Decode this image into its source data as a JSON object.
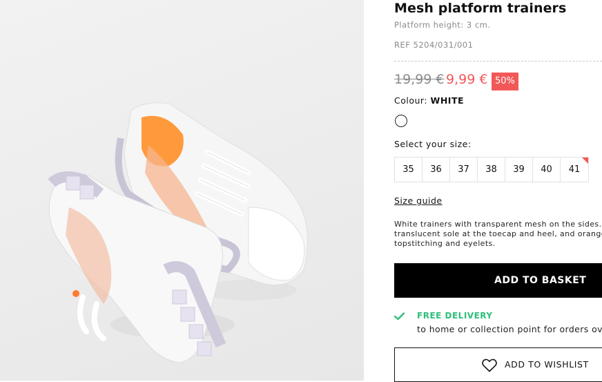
{
  "product": {
    "title": "Mesh platform trainers",
    "subtitle": "Platform height: 3 cm.",
    "ref": "REF 5204/031/001",
    "old_price": "19,99 €",
    "new_price": "9,99 €",
    "discount": "50%",
    "colour_label": "Colour:",
    "colour_value": "WHITE",
    "size_prompt": "Select your size:",
    "sizes": [
      "35",
      "36",
      "37",
      "38",
      "39",
      "40",
      "41"
    ],
    "size_guide": "Size guide",
    "description": "White trainers with transparent mesh on the sides. Fe\ntranslucent sole at the toecap and heel, and orange i\ntopstitching and eyelets."
  },
  "actions": {
    "add_to_basket": "ADD TO BASKET",
    "add_to_wishlist": "ADD TO WISHLIST"
  },
  "delivery": {
    "title": "FREE DELIVERY",
    "text": "to home or collection point for orders over €"
  },
  "colors": {
    "sale": "#f25858",
    "delivery": "#2bbf7a",
    "primary_button": "#000000"
  },
  "icons": [
    "check-icon",
    "heart-icon"
  ]
}
